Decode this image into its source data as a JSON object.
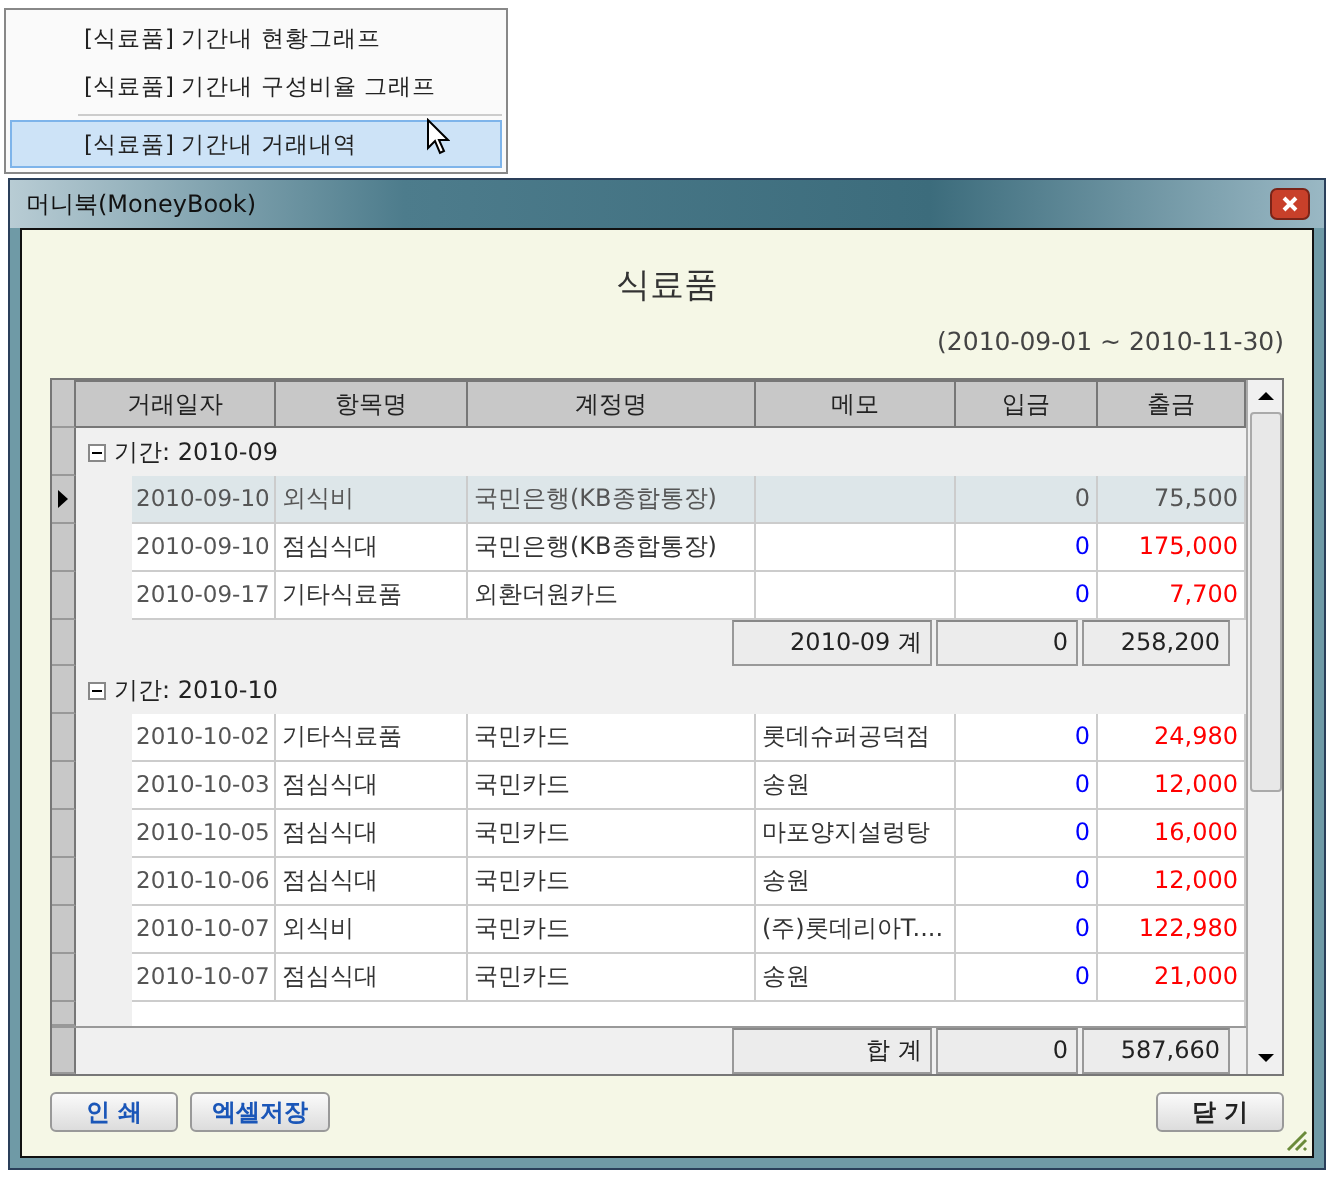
{
  "menu": {
    "items": [
      {
        "label": "[식료품] 기간내 현황그래프",
        "selected": false,
        "kind": "item"
      },
      {
        "label": "[식료품] 기간내 구성비율 그래프",
        "selected": false,
        "kind": "item"
      },
      {
        "kind": "separator"
      },
      {
        "label": "[식료품] 기간내 거래내역",
        "selected": true,
        "kind": "item"
      }
    ]
  },
  "window": {
    "title": "머니북(MoneyBook)"
  },
  "heading": "식료품",
  "period": "(2010-09-01 ~ 2010-11-30)",
  "table": {
    "columns": [
      "거래일자",
      "항목명",
      "계정명",
      "메모",
      "입금",
      "출금"
    ],
    "groups": [
      {
        "label": "기간: 2010-09",
        "expanded": true,
        "rows": [
          {
            "date": "2010-09-10",
            "item": "외식비",
            "account": "국민은행(KB종합통장)",
            "memo": "",
            "in": "0",
            "out": "75,500",
            "selected": true
          },
          {
            "date": "2010-09-10",
            "item": "점심식대",
            "account": "국민은행(KB종합통장)",
            "memo": "",
            "in": "0",
            "out": "175,000",
            "selected": false
          },
          {
            "date": "2010-09-17",
            "item": "기타식료품",
            "account": "외환더원카드",
            "memo": "",
            "in": "0",
            "out": "7,700",
            "selected": false
          }
        ],
        "subtotal": {
          "label": "2010-09 계",
          "in": "0",
          "out": "258,200"
        }
      },
      {
        "label": "기간: 2010-10",
        "expanded": true,
        "rows": [
          {
            "date": "2010-10-02",
            "item": "기타식료품",
            "account": "국민카드",
            "memo": "롯데슈퍼공덕점",
            "in": "0",
            "out": "24,980",
            "selected": false
          },
          {
            "date": "2010-10-03",
            "item": "점심식대",
            "account": "국민카드",
            "memo": "송원",
            "in": "0",
            "out": "12,000",
            "selected": false
          },
          {
            "date": "2010-10-05",
            "item": "점심식대",
            "account": "국민카드",
            "memo": "마포양지설렁탕",
            "in": "0",
            "out": "16,000",
            "selected": false
          },
          {
            "date": "2010-10-06",
            "item": "점심식대",
            "account": "국민카드",
            "memo": "송원",
            "in": "0",
            "out": "12,000",
            "selected": false
          },
          {
            "date": "2010-10-07",
            "item": "외식비",
            "account": "국민카드",
            "memo": "(주)롯데리아T....",
            "in": "0",
            "out": "122,980",
            "selected": false
          },
          {
            "date": "2010-10-07",
            "item": "점심식대",
            "account": "국민카드",
            "memo": "송원",
            "in": "0",
            "out": "21,000",
            "selected": false
          }
        ]
      }
    ],
    "total": {
      "label": "합 계",
      "in": "0",
      "out": "587,660"
    }
  },
  "buttons": {
    "left": [
      "인 쇄",
      "엑셀저장"
    ],
    "right": [
      "닫 기"
    ]
  }
}
